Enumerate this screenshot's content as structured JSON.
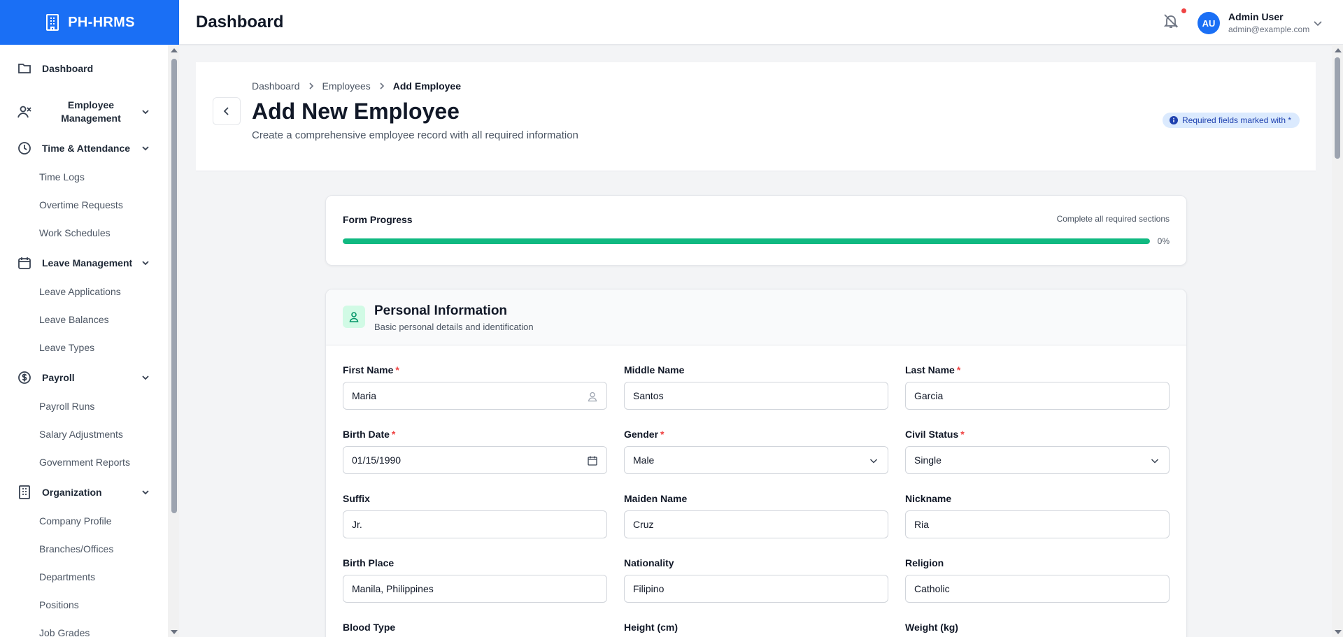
{
  "app": {
    "brand": "PH-HRMS",
    "page_heading": "Dashboard"
  },
  "sidebar": {
    "items": [
      {
        "label": "Dashboard"
      },
      {
        "label": "Employee Management"
      },
      {
        "label": "Time & Attendance",
        "children": [
          "Time Logs",
          "Overtime Requests",
          "Work Schedules"
        ]
      },
      {
        "label": "Leave Management",
        "children": [
          "Leave Applications",
          "Leave Balances",
          "Leave Types"
        ]
      },
      {
        "label": "Payroll",
        "children": [
          "Payroll Runs",
          "Salary Adjustments",
          "Government Reports"
        ]
      },
      {
        "label": "Organization",
        "children": [
          "Company Profile",
          "Branches/Offices",
          "Departments",
          "Positions",
          "Job Grades"
        ]
      }
    ]
  },
  "user": {
    "initials": "AU",
    "name": "Admin User",
    "email": "admin@example.com"
  },
  "breadcrumb": {
    "items": [
      "Dashboard",
      "Employees"
    ],
    "current": "Add Employee"
  },
  "page": {
    "title": "Add New Employee",
    "subtitle": "Create a comprehensive employee record with all required information",
    "required_note": "Required fields marked with *"
  },
  "progress": {
    "title": "Form Progress",
    "hint": "Complete all required sections",
    "percent_label": "0%",
    "fill_fraction": 1.0
  },
  "personal": {
    "title": "Personal Information",
    "subtitle": "Basic personal details and identification",
    "fields": [
      {
        "label": "First Name",
        "required": true,
        "value": "Maria"
      },
      {
        "label": "Middle Name",
        "required": false,
        "value": "Santos"
      },
      {
        "label": "Last Name",
        "required": true,
        "value": "Garcia"
      },
      {
        "label": "Birth Date",
        "required": true,
        "value": "01/15/1990"
      },
      {
        "label": "Gender",
        "required": true,
        "value": "Male"
      },
      {
        "label": "Civil Status",
        "required": true,
        "value": "Single"
      },
      {
        "label": "Suffix",
        "required": false,
        "value": "Jr."
      },
      {
        "label": "Maiden Name",
        "required": false,
        "value": "Cruz"
      },
      {
        "label": "Nickname",
        "required": false,
        "value": "Ria"
      },
      {
        "label": "Birth Place",
        "required": false,
        "value": "Manila, Philippines"
      },
      {
        "label": "Nationality",
        "required": false,
        "value": "Filipino"
      },
      {
        "label": "Religion",
        "required": false,
        "value": "Catholic"
      },
      {
        "label": "Blood Type",
        "required": false,
        "value": ""
      },
      {
        "label": "Height (cm)",
        "required": false,
        "value": ""
      },
      {
        "label": "Weight (kg)",
        "required": false,
        "value": ""
      }
    ]
  },
  "colors": {
    "primary": "#1a6ff5",
    "success": "#10b981",
    "danger": "#ef4444",
    "badge_bg": "#dbeafe"
  },
  "icons": {
    "brand": "building-icon",
    "bell": "bell-icon",
    "back": "chevron-left-icon",
    "user_field": "user-icon",
    "date_field": "calendar-icon",
    "select": "chevron-down-icon",
    "section": "user-icon",
    "info": "info-icon"
  }
}
